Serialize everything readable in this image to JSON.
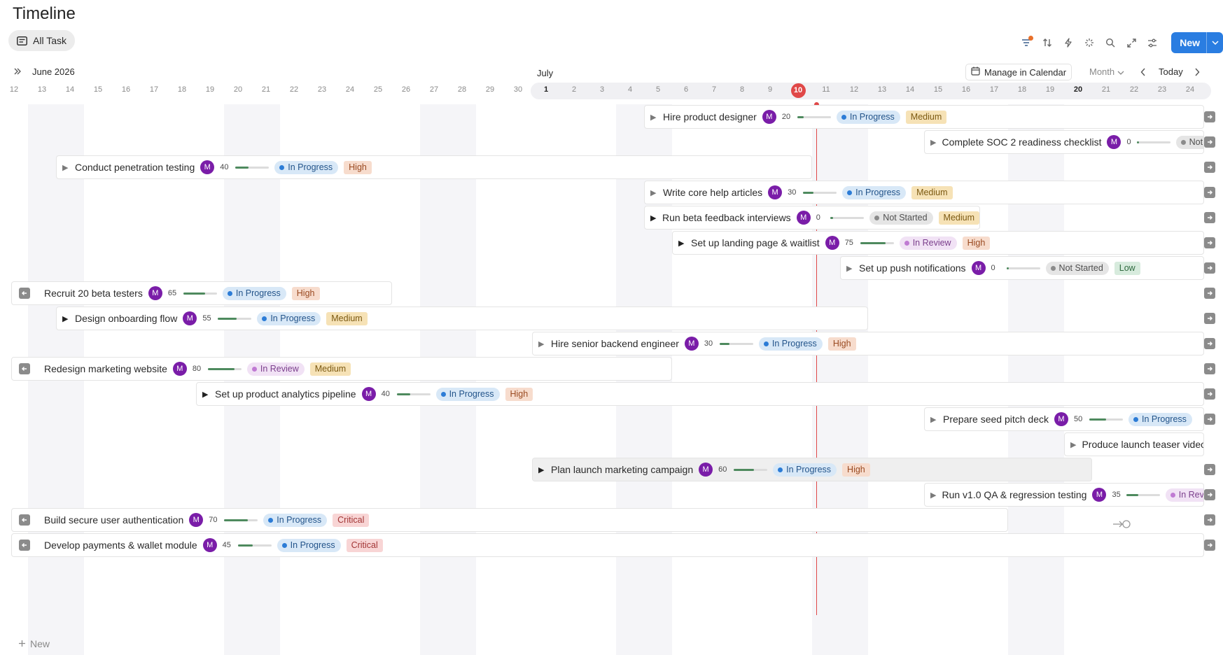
{
  "page": {
    "title": "Timeline"
  },
  "view_tab": {
    "label": "All Task",
    "icon": "list-icon"
  },
  "toolbar": {
    "icons": [
      "filter-icon",
      "sort-icon",
      "lightning-icon",
      "sparkle-icon",
      "search-icon",
      "expand-icon",
      "settings-icon"
    ],
    "new_label": "New"
  },
  "calendar": {
    "june_label": "June 2026",
    "july_label": "July",
    "manage_label": "Manage in Calendar",
    "scale_label": "Month",
    "today_label": "Today",
    "days": [
      {
        "n": "12"
      },
      {
        "n": "13"
      },
      {
        "n": "14"
      },
      {
        "n": "15"
      },
      {
        "n": "16"
      },
      {
        "n": "17"
      },
      {
        "n": "18"
      },
      {
        "n": "19"
      },
      {
        "n": "20"
      },
      {
        "n": "21"
      },
      {
        "n": "22"
      },
      {
        "n": "23"
      },
      {
        "n": "24"
      },
      {
        "n": "25"
      },
      {
        "n": "26"
      },
      {
        "n": "27"
      },
      {
        "n": "28"
      },
      {
        "n": "29"
      },
      {
        "n": "30"
      },
      {
        "n": "1",
        "bold": true
      },
      {
        "n": "2"
      },
      {
        "n": "3"
      },
      {
        "n": "4"
      },
      {
        "n": "5"
      },
      {
        "n": "6"
      },
      {
        "n": "7"
      },
      {
        "n": "8"
      },
      {
        "n": "9"
      },
      {
        "n": "10",
        "today": true
      },
      {
        "n": "11"
      },
      {
        "n": "12"
      },
      {
        "n": "13"
      },
      {
        "n": "14"
      },
      {
        "n": "15"
      },
      {
        "n": "16"
      },
      {
        "n": "17"
      },
      {
        "n": "18"
      },
      {
        "n": "19"
      },
      {
        "n": "20",
        "bold": true
      },
      {
        "n": "21"
      },
      {
        "n": "22"
      },
      {
        "n": "23"
      },
      {
        "n": "24"
      }
    ]
  },
  "tasks": [
    {
      "name": "Hire product designer",
      "assignee": "M",
      "progress": 20,
      "status": "In Progress",
      "priority": "Medium",
      "start": "2026-07-05",
      "end": "2026-07-24",
      "expander": "triangle"
    },
    {
      "name": "Complete SOC 2 readiness checklist",
      "assignee": "M",
      "progress": 0,
      "status": "Not Started",
      "priority": "",
      "start": "2026-07-15",
      "end": "2026-07-24",
      "expander": "triangle"
    },
    {
      "name": "Conduct penetration testing",
      "assignee": "M",
      "progress": 40,
      "status": "In Progress",
      "priority": "High",
      "start": "2026-06-14",
      "end": "2026-07-10",
      "expander": "triangle"
    },
    {
      "name": "Write core help articles",
      "assignee": "M",
      "progress": 30,
      "status": "In Progress",
      "priority": "Medium",
      "start": "2026-07-05",
      "end": "2026-07-24",
      "expander": "triangle"
    },
    {
      "name": "Run beta feedback interviews",
      "assignee": "M",
      "progress": 0,
      "status": "Not Started",
      "priority": "Medium",
      "start": "2026-07-05",
      "end": "2026-07-16",
      "expander": "triangle-dark"
    },
    {
      "name": "Set up landing page & waitlist",
      "assignee": "M",
      "progress": 75,
      "status": "In Review",
      "priority": "High",
      "start": "2026-07-06",
      "end": "2026-07-24",
      "expander": "triangle-dark"
    },
    {
      "name": "Set up push notifications",
      "assignee": "M",
      "progress": 0,
      "status": "Not Started",
      "priority": "Low",
      "start": "2026-07-12",
      "end": "2026-07-24",
      "expander": "triangle"
    },
    {
      "name": "Recruit 20 beta testers",
      "assignee": "M",
      "progress": 65,
      "status": "In Progress",
      "priority": "High",
      "start": "2026-06-11",
      "end": "2026-06-25",
      "expander": "back"
    },
    {
      "name": "Design onboarding flow",
      "assignee": "M",
      "progress": 55,
      "status": "In Progress",
      "priority": "Medium",
      "start": "2026-06-14",
      "end": "2026-07-12",
      "expander": "triangle-dark"
    },
    {
      "name": "Hire senior backend engineer",
      "assignee": "M",
      "progress": 30,
      "status": "In Progress",
      "priority": "High",
      "start": "2026-07-01",
      "end": "2026-07-24",
      "expander": "triangle"
    },
    {
      "name": "Redesign marketing website",
      "assignee": "M",
      "progress": 80,
      "status": "In Review",
      "priority": "Medium",
      "start": "2026-06-11",
      "end": "2026-07-05",
      "expander": "back"
    },
    {
      "name": "Set up product analytics pipeline",
      "assignee": "M",
      "progress": 40,
      "status": "In Progress",
      "priority": "High",
      "start": "2026-06-19",
      "end": "2026-07-24",
      "expander": "triangle-dark"
    },
    {
      "name": "Prepare seed pitch deck",
      "assignee": "M",
      "progress": 50,
      "status": "In Progress",
      "priority": "",
      "start": "2026-07-15",
      "end": "2026-07-24",
      "expander": "triangle"
    },
    {
      "name": "Produce launch teaser video",
      "assignee": "",
      "progress": null,
      "status": "",
      "priority": "",
      "start": "2026-07-20",
      "end": "2026-07-24",
      "expander": "triangle"
    },
    {
      "name": "Plan launch marketing campaign",
      "assignee": "M",
      "progress": 60,
      "status": "In Progress",
      "priority": "High",
      "start": "2026-07-01",
      "end": "2026-07-20",
      "expander": "triangle-dark",
      "highlight": true
    },
    {
      "name": "Run v1.0 QA & regression testing",
      "assignee": "M",
      "progress": 35,
      "status": "In Review",
      "priority": "",
      "start": "2026-07-15",
      "end": "2026-07-24",
      "expander": "triangle"
    },
    {
      "name": "Build secure user authentication",
      "assignee": "M",
      "progress": 70,
      "status": "In Progress",
      "priority": "Critical",
      "start": "2026-06-11",
      "end": "2026-07-17",
      "expander": "back"
    },
    {
      "name": "Develop payments & wallet module",
      "assignee": "M",
      "progress": 45,
      "status": "In Progress",
      "priority": "Critical",
      "start": "2026-06-11",
      "end": "2026-07-24",
      "expander": "back"
    }
  ],
  "footer": {
    "new_label": "New"
  },
  "colors": {
    "accent": "#2a7de1",
    "today": "#e04848",
    "avatar": "#7a1da8",
    "progress": "#4e8a5e"
  }
}
